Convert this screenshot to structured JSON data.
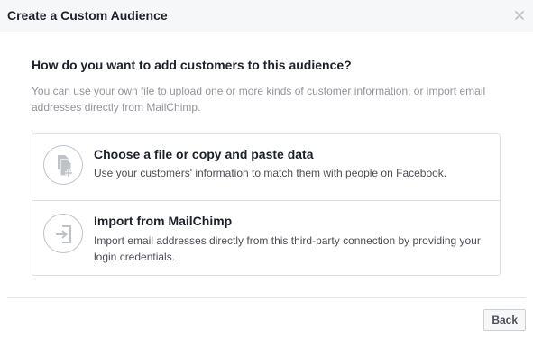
{
  "dialog": {
    "title": "Create a Custom Audience",
    "close_icon": "close-icon"
  },
  "main": {
    "question": "How do you want to add customers to this audience?",
    "description": "You can use your own file to upload one or more kinds of customer information, or import email addresses directly from MailChimp.",
    "options": [
      {
        "icon": "file-add-icon",
        "title": "Choose a file or copy and paste data",
        "description": "Use your customers' information to match them with people on Facebook."
      },
      {
        "icon": "import-icon",
        "title": "Import from MailChimp",
        "description": "Import email addresses directly from this third-party connection by providing your login credentials."
      }
    ]
  },
  "footer": {
    "back_label": "Back"
  },
  "colors": {
    "header_bg": "#f6f7f9",
    "border": "#dddfe2",
    "icon_gray": "#bec2c9",
    "text_primary": "#1d2129",
    "text_secondary": "#90949c"
  }
}
